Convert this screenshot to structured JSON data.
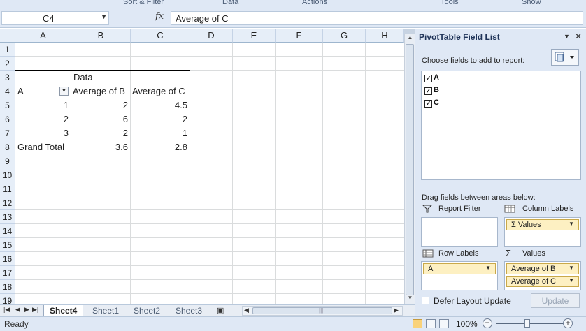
{
  "ribbon": {
    "groups": [
      "Sort & Filter",
      "Data",
      "Actions",
      "Tools",
      "Show"
    ]
  },
  "formula_bar": {
    "name_box": "C4",
    "fx_label": "fx",
    "formula": "Average of C"
  },
  "sheet": {
    "columns": [
      "A",
      "B",
      "C",
      "D",
      "E",
      "F",
      "G",
      "H"
    ],
    "rows": [
      "1",
      "2",
      "3",
      "4",
      "5",
      "6",
      "7",
      "8",
      "9",
      "10",
      "11",
      "12",
      "13",
      "14",
      "15",
      "16",
      "17",
      "18",
      "19"
    ],
    "pivot": {
      "data_header": "Data",
      "row_field": "A",
      "col_b_header": "Average of B",
      "col_c_header": "Average of C",
      "rows": [
        {
          "a": "1",
          "b": "2",
          "c": "4.5"
        },
        {
          "a": "2",
          "b": "6",
          "c": "2"
        },
        {
          "a": "3",
          "b": "2",
          "c": "1"
        }
      ],
      "total_label": "Grand Total",
      "total_b": "3.6",
      "total_c": "2.8"
    }
  },
  "tabs": {
    "sheets": [
      "Sheet4",
      "Sheet1",
      "Sheet2",
      "Sheet3"
    ],
    "active": "Sheet4"
  },
  "status": {
    "text": "Ready",
    "zoom": "100%",
    "zoom_minus": "−",
    "zoom_plus": "+"
  },
  "pivot_pane": {
    "title": "PivotTable Field List",
    "choose_label": "Choose fields to add to report:",
    "fields": [
      {
        "name": "A",
        "checked": true
      },
      {
        "name": "B",
        "checked": true
      },
      {
        "name": "C",
        "checked": true
      }
    ],
    "drag_label": "Drag fields between areas below:",
    "report_filter_label": "Report Filter",
    "column_labels_label": "Column Labels",
    "row_labels_label": "Row Labels",
    "values_label": "Values",
    "column_chip": "Σ Values",
    "row_chip": "A",
    "value_chips": [
      "Average of B",
      "Average of C"
    ],
    "defer_label": "Defer Layout Update",
    "update_label": "Update"
  },
  "colors": {
    "chrome": "#dfe8f5",
    "header": "#e6eef8",
    "chip": "#fdf0c2",
    "pane_title": "#1f3358"
  }
}
